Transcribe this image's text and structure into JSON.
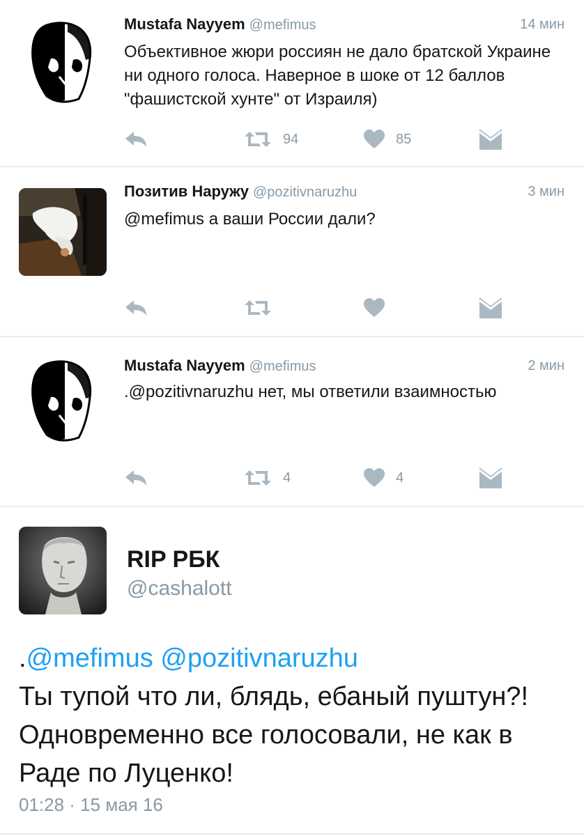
{
  "tweets": [
    {
      "name": "Mustafa Nayyem",
      "handle": "@mefimus",
      "time": "14 мин",
      "text": "Объективное жюри россиян не дало братской Украине ни одного голоса. Наверное в шоке от 12 баллов \"фашистской хунте\" от Израиля)",
      "retweets": "94",
      "likes": "85",
      "avatar_icon": "skull-icon"
    },
    {
      "name": "Позитив Наружу",
      "handle": "@pozitivnaruzhu",
      "time": "3 мин",
      "text": "@mefimus а ваши России дали?",
      "retweets": "",
      "likes": "",
      "avatar_icon": "cat-photo"
    },
    {
      "name": "Mustafa Nayyem",
      "handle": "@mefimus",
      "time": "2 мин",
      "text": ".@pozitivnaruzhu нет, мы ответили взаимностью",
      "retweets": "4",
      "likes": "4",
      "avatar_icon": "skull-icon"
    }
  ],
  "main_tweet": {
    "name": "RIP РБК",
    "handle": "@cashalott",
    "mention_prefix": ".",
    "mention1": "@mefimus",
    "mention2": "@pozitivnaruzhu",
    "text": "Ты тупой что ли, блядь, ебаный пуштун?! Одновременно все голосовали, не как в Раде по Луценко!",
    "date": "01:28 · 15 мая 16",
    "avatar_icon": "bust-photo"
  },
  "colors": {
    "icon": "#aab8c2",
    "link": "#1da1f2",
    "meta": "#8899a6",
    "divider": "#e6ecf0"
  }
}
